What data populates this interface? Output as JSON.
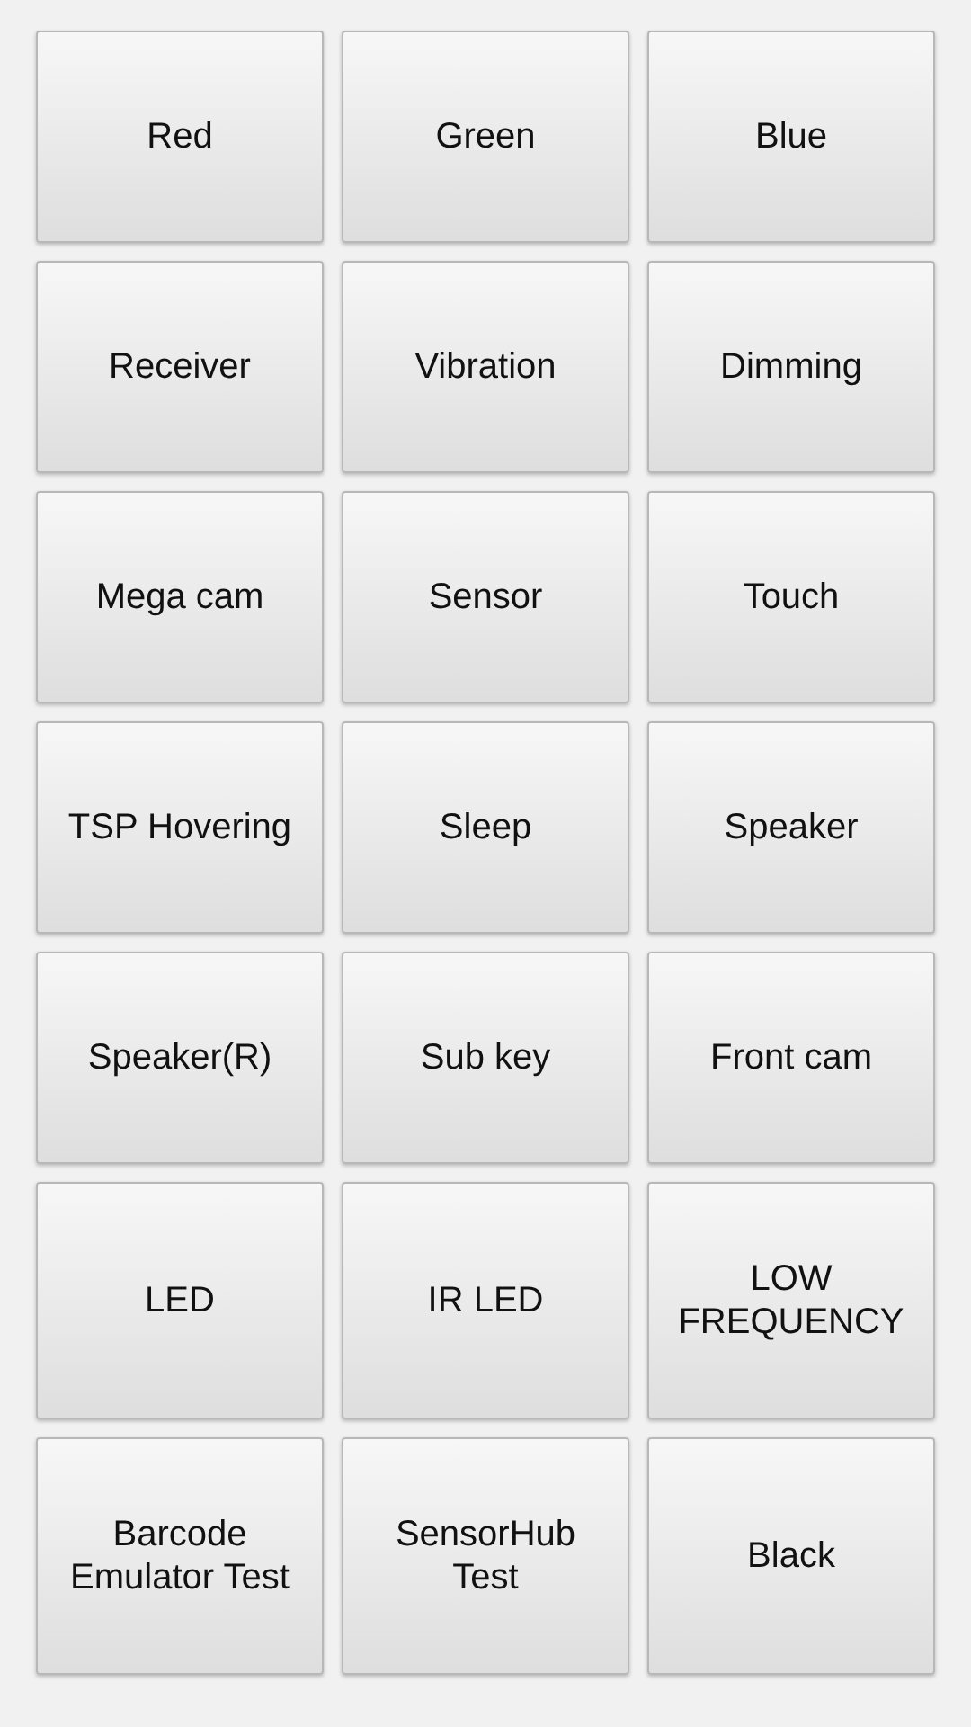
{
  "buttons": [
    {
      "label": "Red"
    },
    {
      "label": "Green"
    },
    {
      "label": "Blue"
    },
    {
      "label": "Receiver"
    },
    {
      "label": "Vibration"
    },
    {
      "label": "Dimming"
    },
    {
      "label": "Mega cam"
    },
    {
      "label": "Sensor"
    },
    {
      "label": "Touch"
    },
    {
      "label": "TSP Hovering"
    },
    {
      "label": "Sleep"
    },
    {
      "label": "Speaker"
    },
    {
      "label": "Speaker(R)"
    },
    {
      "label": "Sub key"
    },
    {
      "label": "Front cam"
    },
    {
      "label": "LED"
    },
    {
      "label": "IR LED"
    },
    {
      "label": "LOW\nFREQUENCY"
    },
    {
      "label": "Barcode\nEmulator Test"
    },
    {
      "label": "SensorHub\nTest"
    },
    {
      "label": "Black"
    }
  ]
}
